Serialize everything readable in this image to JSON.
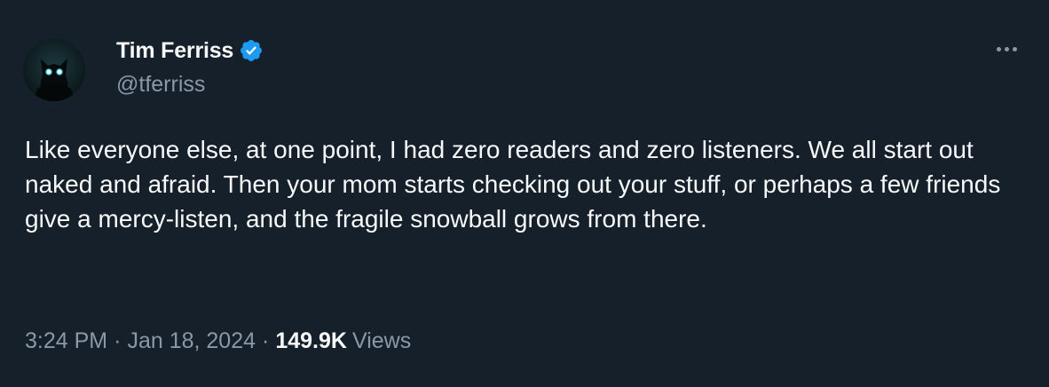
{
  "author": {
    "display_name": "Tim Ferriss",
    "handle": "@tferriss",
    "verified_icon": "verified-badge-icon",
    "avatar_icon": "wolf-avatar"
  },
  "tweet": {
    "text": "Like everyone else, at one point, I had zero readers and zero listeners. We all start out naked and afraid. Then your mom starts checking out your stuff, or perhaps a few friends give a mercy-listen, and the fragile snowball grows from there."
  },
  "meta": {
    "time": "3:24 PM",
    "separator": "·",
    "date": "Jan 18, 2024",
    "views_count": "149.9K",
    "views_label": "Views"
  },
  "colors": {
    "background": "#15202b",
    "primary_text": "#f7f9f9",
    "secondary_text": "#8b98a5",
    "verified_blue": "#1d9bf0"
  },
  "more_icon": "more-horizontal-icon"
}
